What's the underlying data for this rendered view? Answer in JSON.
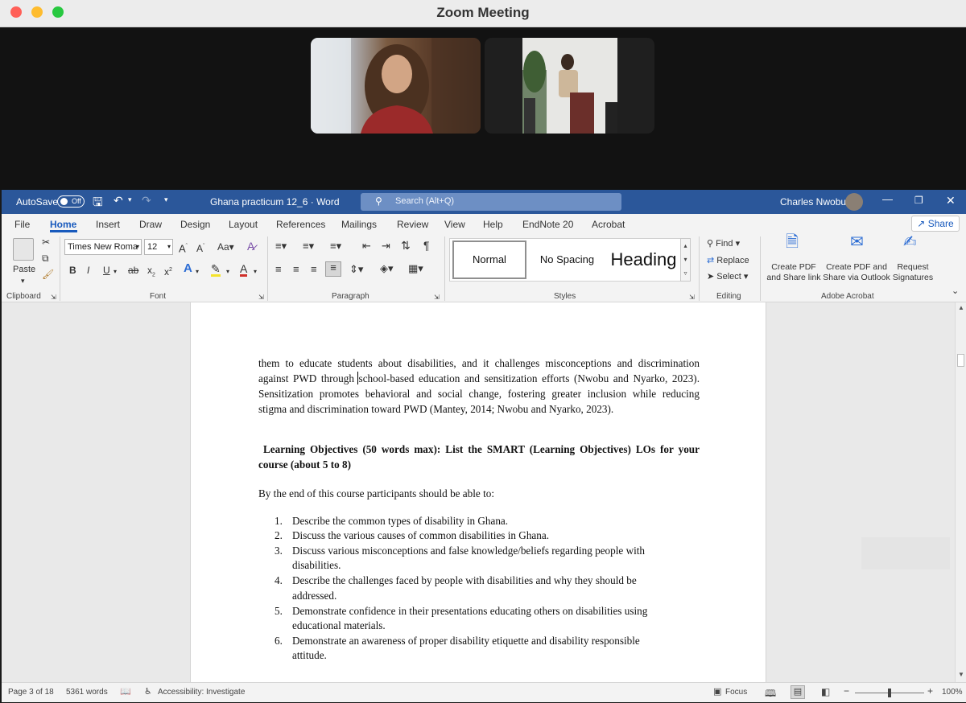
{
  "zoom": {
    "title": "Zoom Meeting"
  },
  "word": {
    "autosave_label": "AutoSave",
    "autosave_state": "Off",
    "doc_title": "Ghana practicum 12_6  ·  Word",
    "search_placeholder": "Search (Alt+Q)",
    "user_name": "Charles Nwobu",
    "tabs": [
      "File",
      "Home",
      "Insert",
      "Draw",
      "Design",
      "Layout",
      "References",
      "Mailings",
      "Review",
      "View",
      "Help",
      "EndNote 20",
      "Acrobat"
    ],
    "share_label": "Share",
    "ribbon": {
      "paste_label": "Paste",
      "clipboard_label": "Clipboard",
      "font_name": "Times New Roma",
      "font_size": "12",
      "font_label": "Font",
      "paragraph_label": "Paragraph",
      "styles": [
        "Normal",
        "No Spacing",
        "Heading"
      ],
      "styles_label": "Styles",
      "find_label": "Find",
      "replace_label": "Replace",
      "select_label": "Select",
      "editing_label": "Editing",
      "create_pdf_label": "Create PDF and Share link",
      "create_pdf_outlook_label": "Create PDF and Share via Outlook",
      "request_sig_label": "Request Signatures",
      "acrobat_label": "Adobe Acrobat"
    },
    "document": {
      "para1": [
        "them to educate students about disabilities, and it challenges misconceptions and discrimination",
        "against PWD through school-based education and sensitization efforts (Nwobu and Nyarko, 2023).",
        "Sensitization promotes behavioral and social change, fostering greater inclusion while reducing",
        "stigma and discrimination toward PWD (Mantey, 2014; Nwobu and Nyarko, 2023)."
      ],
      "heading_line1": " Learning Objectives (50 words max): List the SMART (Learning Objectives) LOs for your",
      "heading_line2": "course (about 5 to 8)",
      "intro": "By the end of this course participants should be able to:",
      "objectives": [
        [
          "1.",
          "Describe the common types of disability in Ghana.",
          ""
        ],
        [
          "2.",
          "Discuss the various causes of common disabilities in Ghana.",
          ""
        ],
        [
          "3.",
          "Discuss various misconceptions and false knowledge/beliefs regarding people with",
          "disabilities."
        ],
        [
          "4.",
          "Describe the challenges faced by people with disabilities and why they should be",
          "addressed."
        ],
        [
          "5.",
          "Demonstrate confidence in their presentations educating others on disabilities using",
          "educational materials."
        ],
        [
          "6.",
          "Demonstrate an awareness of proper disability etiquette and disability responsible",
          "attitude."
        ]
      ]
    },
    "status": {
      "page": "Page 3 of 18",
      "words": "5361 words",
      "accessibility": "Accessibility: Investigate",
      "focus": "Focus",
      "zoom": "100%"
    }
  },
  "colors": {
    "word_blue": "#2b579a",
    "accent": "#185abd"
  }
}
